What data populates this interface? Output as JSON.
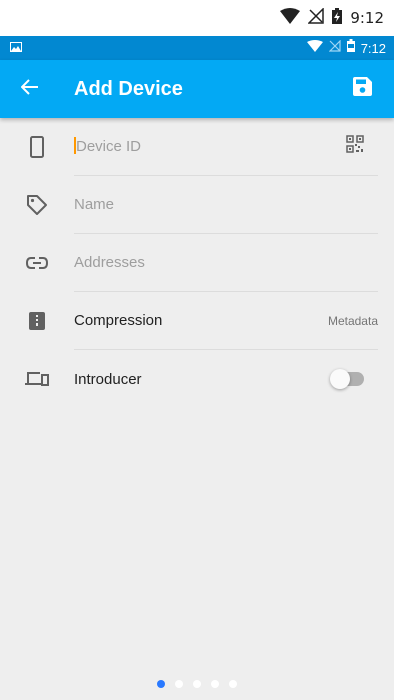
{
  "system_status": {
    "time": "9:12"
  },
  "device_status": {
    "time": "7:12"
  },
  "appbar": {
    "title": "Add Device",
    "back_icon": "arrow-left-icon",
    "save_icon": "save-icon"
  },
  "fields": {
    "device_id": {
      "placeholder": "Device ID",
      "value": ""
    },
    "name": {
      "placeholder": "Name",
      "value": ""
    },
    "addresses": {
      "placeholder": "Addresses",
      "value": ""
    }
  },
  "compression": {
    "label": "Compression",
    "value": "Metadata"
  },
  "introducer": {
    "label": "Introducer",
    "enabled": false
  },
  "pager": {
    "count": 5,
    "active": 1
  },
  "colors": {
    "primary": "#03a9f4",
    "primary_dark": "#0288d1",
    "background": "#eeeeee",
    "cursor": "#ff9800",
    "dot_active": "#2979ff"
  }
}
